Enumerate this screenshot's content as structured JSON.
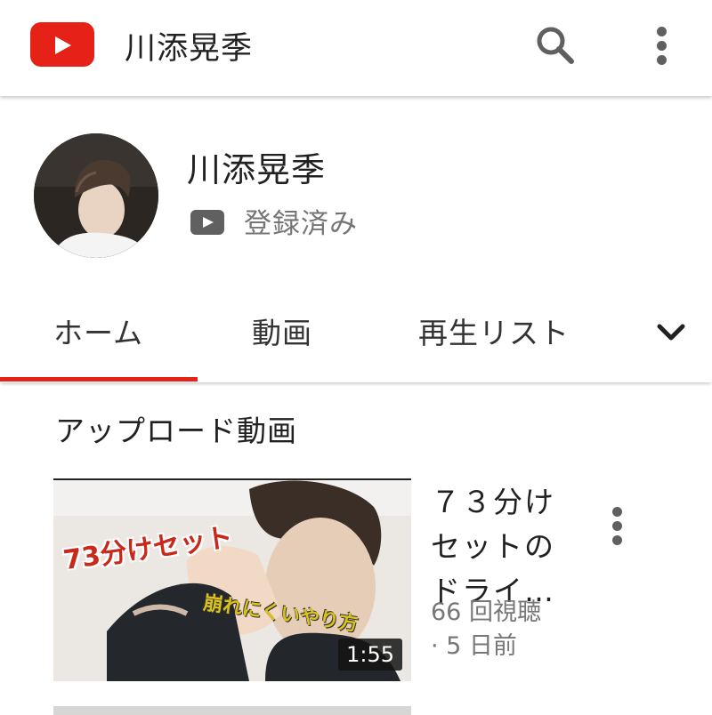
{
  "app_bar": {
    "title": "川添晃季",
    "logo_icon": "youtube-logo-icon",
    "search_icon": "search-icon",
    "more_icon": "more-vert-icon",
    "brand_color": "#e62117"
  },
  "channel": {
    "name": "川添晃季",
    "subscribe_status": "登録済み",
    "subscribe_icon": "youtube-play-icon"
  },
  "tabs": {
    "items": [
      {
        "label": "ホーム",
        "selected": true
      },
      {
        "label": "動画",
        "selected": false
      },
      {
        "label": "再生リスト",
        "selected": false
      }
    ],
    "expand_icon": "chevron-down-icon"
  },
  "section": {
    "title": "アップロード動画"
  },
  "videos": [
    {
      "title": "７３分けセットのドライ…",
      "thumbnail_caption_1": "73分けセット",
      "thumbnail_caption_2": "崩れにくいやり方",
      "duration": "1:55",
      "views": "66 回視聴",
      "age": "· 5 日前"
    }
  ]
}
